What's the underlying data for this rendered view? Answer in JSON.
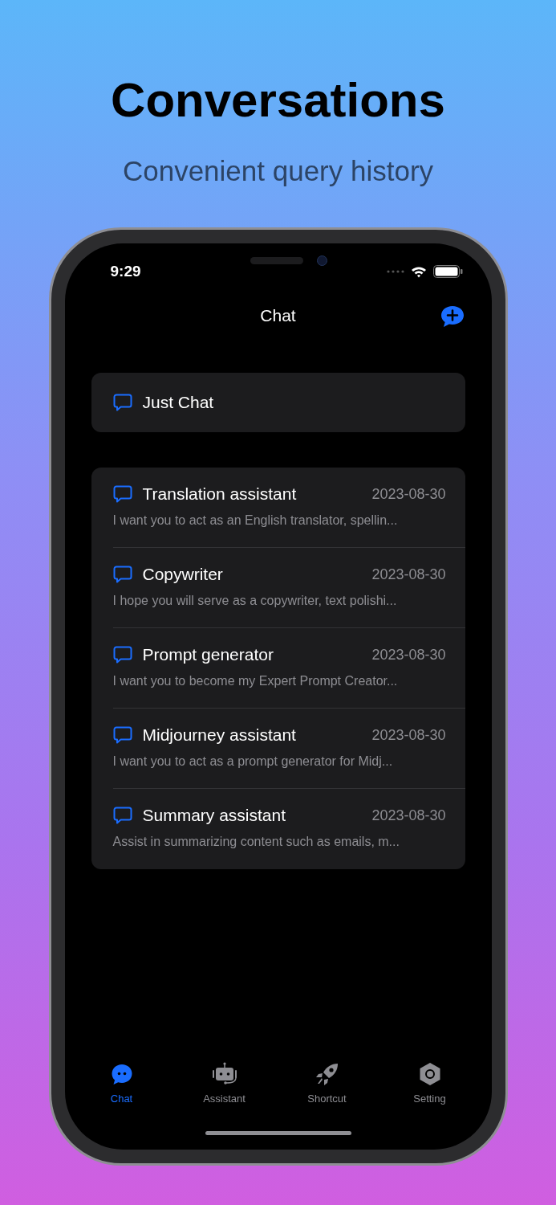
{
  "headline": "Conversations",
  "subheadline": "Convenient query history",
  "status_bar": {
    "time": "9:29"
  },
  "nav": {
    "title": "Chat"
  },
  "just_chat": {
    "title": "Just Chat"
  },
  "conversations": [
    {
      "title": "Translation assistant",
      "date": "2023-08-30",
      "preview": "I want you to act as an English translator, spellin..."
    },
    {
      "title": "Copywriter",
      "date": "2023-08-30",
      "preview": "I hope you will serve as a copywriter, text polishi..."
    },
    {
      "title": "Prompt generator",
      "date": "2023-08-30",
      "preview": "I want you to become my Expert Prompt Creator..."
    },
    {
      "title": "Midjourney assistant",
      "date": "2023-08-30",
      "preview": "I want you to act as a prompt generator for Midj..."
    },
    {
      "title": "Summary assistant",
      "date": "2023-08-30",
      "preview": "Assist in summarizing content such as emails, m..."
    }
  ],
  "tabs": [
    {
      "kind": "chat",
      "label": "Chat",
      "selected": true
    },
    {
      "kind": "assistant",
      "label": "Assistant",
      "selected": false
    },
    {
      "kind": "shortcut",
      "label": "Shortcut",
      "selected": false
    },
    {
      "kind": "setting",
      "label": "Setting",
      "selected": false
    }
  ]
}
